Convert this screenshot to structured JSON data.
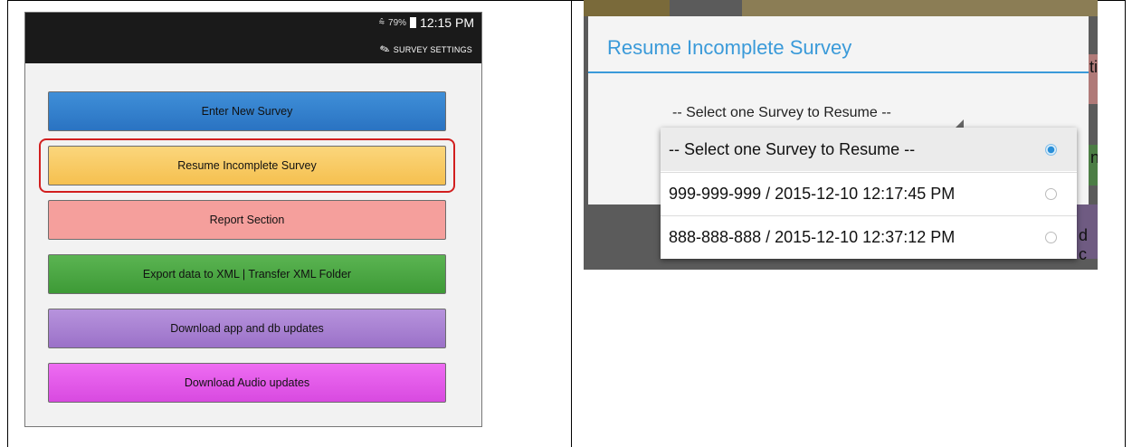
{
  "phone": {
    "status": {
      "wifi": "⩯",
      "battery_pct": "79%",
      "time": "12:15 PM"
    },
    "settings_label": "SURVEY SETTINGS",
    "buttons": [
      {
        "label": "Enter New Survey",
        "color": "#2f7fcc"
      },
      {
        "label": "Resume Incomplete Survey",
        "color": "#f7c65a"
      },
      {
        "label": "Report Section",
        "color": "#f59f9c"
      },
      {
        "label": "Export data to XML | Transfer XML Folder",
        "color": "#4aa742"
      },
      {
        "label": "Download app and db updates",
        "color": "#a47dd0"
      },
      {
        "label": "Download Audio updates",
        "color": "#e45ae8"
      }
    ],
    "highlight_color": "#d21f1f"
  },
  "dialog": {
    "title": "Resume Incomplete Survey",
    "accent": "#3a9ad9",
    "spinner_value": "-- Select one Survey to Resume --",
    "options": [
      {
        "label": "-- Select one Survey to Resume --",
        "selected": true
      },
      {
        "label": "999-999-999 / 2015-12-10 12:17:45 PM",
        "selected": false
      },
      {
        "label": "888-888-888 / 2015-12-10 12:37:12 PM",
        "selected": false
      }
    ],
    "background_fragments": [
      "ti",
      "n",
      "d c"
    ]
  }
}
